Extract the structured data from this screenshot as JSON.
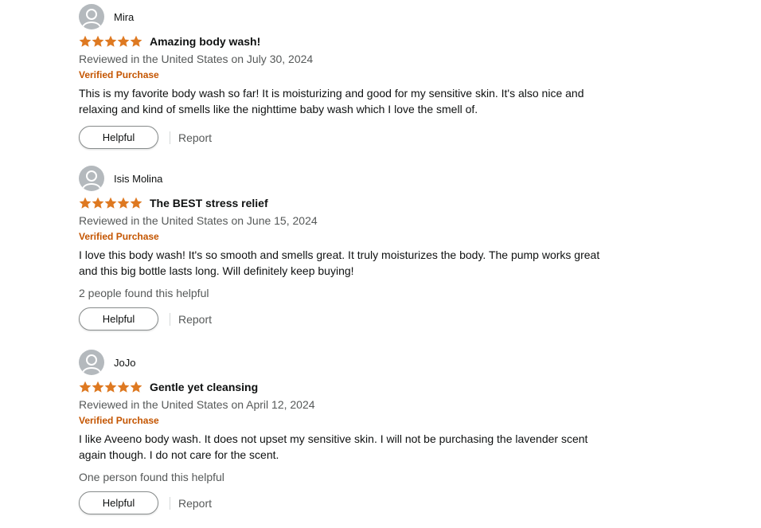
{
  "colors": {
    "star": "#de7921",
    "verified": "#c45500",
    "secondary_text": "#565959",
    "avatar_bg": "#b4b9bd"
  },
  "reviews": [
    {
      "reviewer": "Mira",
      "rating": 5,
      "title": "Amazing body wash!",
      "date": "Reviewed in the United States on July 30, 2024",
      "verified": "Verified Purchase",
      "body_line1": "This is my favorite body wash so far! It is moisturizing and good for my sensitive skin. It's also nice and",
      "body_line2": "relaxing and kind of smells like the nighttime baby wash which I love the smell of.",
      "helpful_count": "",
      "helpful_label": "Helpful",
      "report_label": "Report"
    },
    {
      "reviewer": "Isis Molina",
      "rating": 5,
      "title": "The BEST stress relief",
      "date": "Reviewed in the United States on June 15, 2024",
      "verified": "Verified Purchase",
      "body_line1": "I love this body wash! It's so smooth and smells great. It truly moisturizes the body. The pump works great",
      "body_line2": "and this big bottle lasts long. Will definitely keep buying!",
      "helpful_count": "2 people found this helpful",
      "helpful_label": "Helpful",
      "report_label": "Report"
    },
    {
      "reviewer": "JoJo",
      "rating": 5,
      "title": "Gentle yet cleansing",
      "date": "Reviewed in the United States on April 12, 2024",
      "verified": "Verified Purchase",
      "body_line1": "I like Aveeno body wash. It does not upset my sensitive skin. I will not be purchasing the lavender scent",
      "body_line2": "again though. I do not care for the scent.",
      "helpful_count": "One person found this helpful",
      "helpful_label": "Helpful",
      "report_label": "Report"
    }
  ]
}
